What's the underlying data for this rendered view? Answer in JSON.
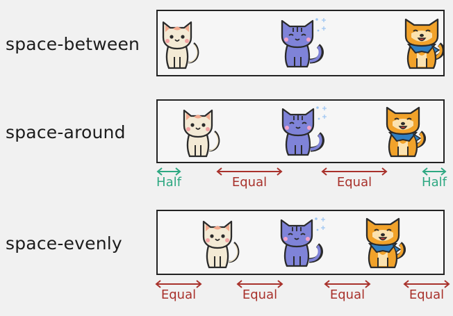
{
  "colors": {
    "half": "#2ea882",
    "equal": "#a8312b"
  },
  "rows": [
    {
      "label": "space-between",
      "arrows": []
    },
    {
      "label": "space-around",
      "arrows": [
        "Half",
        "Equal",
        "Equal",
        "Half"
      ]
    },
    {
      "label": "space-evenly",
      "arrows": [
        "Equal",
        "Equal",
        "Equal",
        "Equal"
      ]
    }
  ],
  "icons": [
    "cat-icon",
    "blue-cat-icon",
    "shiba-dog-icon"
  ]
}
